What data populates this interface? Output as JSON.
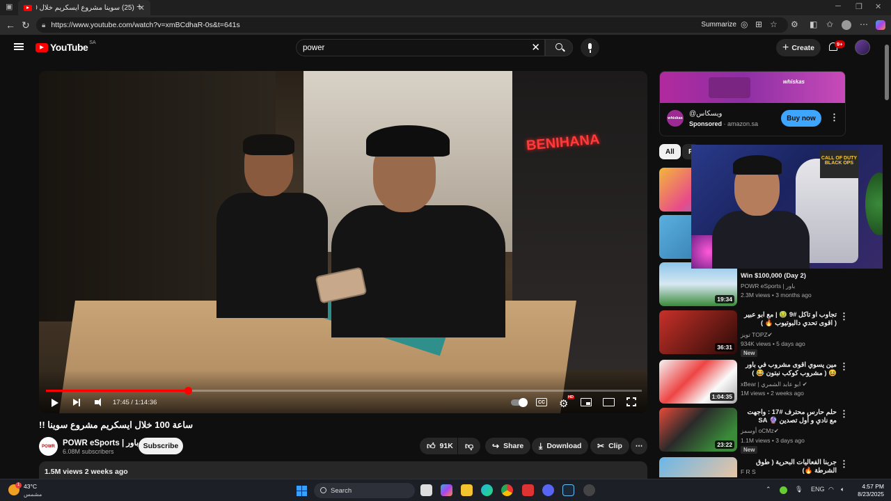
{
  "browser": {
    "tab_title": "(25) سوينا مشروع ايسكريم خلال 100...",
    "url": "https://www.youtube.com/watch?v=xmBCdhaR-0s&t=641s",
    "summarize_label": "Summarize",
    "new_tab_label": "+"
  },
  "youtube": {
    "logo_text": "YouTube",
    "country_code": "SA",
    "search_value": "power",
    "create_label": "Create",
    "notification_count": "9+"
  },
  "player": {
    "current_time": "17:45",
    "duration": "1:14:36",
    "time_display": "17:45 / 1:14:36",
    "progress_fraction": 0.238,
    "neon_sign": "BENIHANA",
    "cc_label": "CC",
    "hd_label": "HD"
  },
  "video": {
    "title": "!! ساعة 100 خلال ايسكريم مشروع سوينا",
    "channel_name": "POWR eSports | باور",
    "channel_avatar_text": "POWR",
    "subscribers": "6.08M subscribers",
    "subscribe_label": "Subscribe",
    "likes": "91K",
    "share_label": "Share",
    "download_label": "Download",
    "clip_label": "Clip",
    "views_line": "1.5M views  2 weeks ago"
  },
  "ad": {
    "advertiser": "@ويسكاس",
    "avatar_text": "whiskas",
    "sponsored": "Sponsored",
    "domain": "amazon.sa",
    "buy_label": "Buy now",
    "banner_brand": "whiskas"
  },
  "chips": [
    "All",
    "F"
  ],
  "webcam": {
    "poster_text": "CALL OF DUTY BLACK OPS"
  },
  "related": [
    {
      "title": "Win $100,000 (Day 2)",
      "channel": "POWR eSports | باور",
      "meta": "2.3M views • 3 months ago",
      "duration": "19:34",
      "is_new": false
    },
    {
      "title": "تجاوب او تاكل #9 🤢 | مع ابو عبير ( اقوى تحدي دالبوتيوب 🔥 )",
      "channel": "تويز TOPZ✔",
      "meta": "934K views • 5 days ago",
      "duration": "36:31",
      "is_new": true,
      "new_label": "New"
    },
    {
      "title": "مين يسوي اقوى مشروب في باور 😆 ( مشروب كوكب نبتون 😂 )",
      "channel": "xBear | ابو عابد الشمري ✔",
      "meta": "1M views • 2 weeks ago",
      "duration": "1:04:35",
      "is_new": false
    },
    {
      "title": "حلم حارس محترف #17 : واجهت مع نادي و أول تصدين 🔮 SA",
      "channel": "أوسمز oCMz✔",
      "meta": "1.1M views • 3 days ago",
      "duration": "23:22",
      "is_new": true,
      "new_label": "New"
    },
    {
      "title": "جربنا الفعاليات البحرية ( طوق الشرطة 🔥)",
      "channel": "F R S",
      "meta": "",
      "duration": "",
      "is_new": false
    }
  ],
  "taskbar": {
    "temperature": "43°C",
    "weather_desc": "مشمس",
    "weather_badge": "1",
    "search_label": "Search",
    "language": "ENG",
    "time": "4:57 PM",
    "date": "8/23/2025"
  }
}
